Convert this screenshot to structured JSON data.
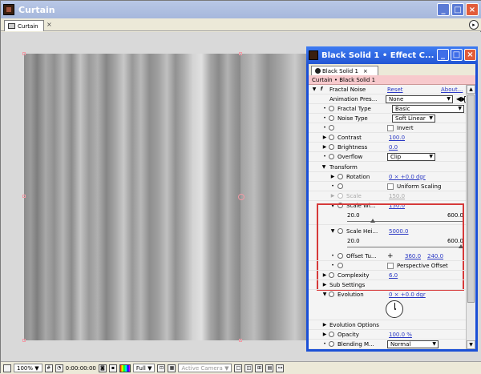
{
  "main_window": {
    "title": "Curtain",
    "tab_label": "Curtain",
    "tab_close": "×",
    "menu_arrow": "▸"
  },
  "window_buttons": {
    "minimize": "_",
    "maximize": "□",
    "close": "×"
  },
  "statusbar": {
    "zoom": "100%",
    "timecode": "0:00:00:00",
    "resolution": "Full",
    "camera": "Active Camera"
  },
  "effect_controls": {
    "title": "Black Solid 1 • Effect C...",
    "tab_label": "Black Solid 1",
    "tab_close": "×",
    "breadcrumb": "Curtain • Black Solid 1",
    "effect": {
      "name": "Fractal Noise",
      "reset": "Reset",
      "about": "About..."
    },
    "params": {
      "animation_presets": {
        "label": "Animation Pres...",
        "value": "None"
      },
      "fractal_type": {
        "label": "Fractal Type",
        "value": "Basic"
      },
      "noise_type": {
        "label": "Noise Type",
        "value": "Soft Linear"
      },
      "invert": {
        "label": "Invert"
      },
      "contrast": {
        "label": "Contrast",
        "value": "100.0"
      },
      "brightness": {
        "label": "Brightness",
        "value": "0.0"
      },
      "overflow": {
        "label": "Overflow",
        "value": "Clip"
      },
      "transform": {
        "label": "Transform"
      },
      "rotation": {
        "label": "Rotation",
        "value": "0 × +0.0 dgr"
      },
      "uniform_scaling": {
        "label": "Uniform Scaling"
      },
      "scale": {
        "label": "Scale",
        "value": "150.0"
      },
      "scale_width": {
        "label": "Scale Wi...",
        "value": "150.0",
        "min": "20.0",
        "max": "600.0",
        "fraction": 0.224
      },
      "scale_height": {
        "label": "Scale Hei...",
        "value": "5000.0",
        "min": "20.0",
        "max": "600.0",
        "fraction": 1.0
      },
      "offset_turbulence": {
        "label": "Offset Tu...",
        "x": "360.0",
        "y": "240.0"
      },
      "perspective_offset": {
        "label": "Perspective Offset"
      },
      "complexity": {
        "label": "Complexity",
        "value": "6.0"
      },
      "sub_settings": {
        "label": "Sub Settings"
      },
      "evolution": {
        "label": "Evolution",
        "value": "0 × +0.0 dgr"
      },
      "evolution_options": {
        "label": "Evolution Options"
      },
      "opacity": {
        "label": "Opacity",
        "value": "100.0 %"
      },
      "blending_mode": {
        "label": "Blending M...",
        "value": "Normal"
      }
    }
  }
}
